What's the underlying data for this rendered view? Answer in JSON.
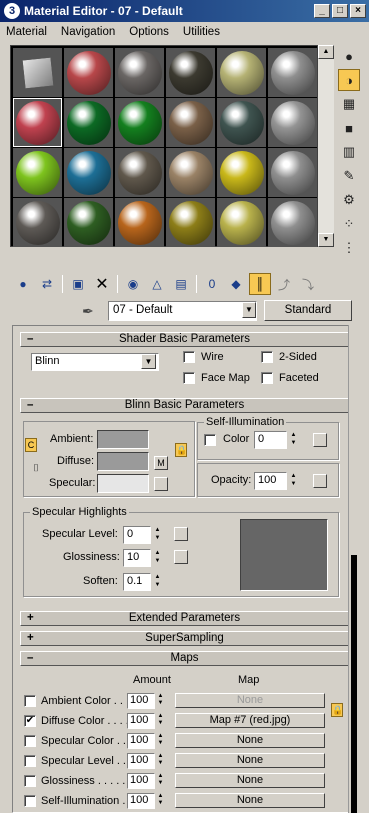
{
  "window": {
    "title": "Material Editor - 07 - Default",
    "logo": "3"
  },
  "menu": [
    "Material",
    "Navigation",
    "Options",
    "Utilities"
  ],
  "slots": [
    {
      "icon": "cube-icon"
    },
    {
      "color": "#b8474a"
    },
    {
      "color": "#6a6664"
    },
    {
      "color": "#3c3a30"
    },
    {
      "color": "#b5b274"
    },
    {
      "color": "#8f8f8f"
    },
    {
      "color": "#c0424f"
    },
    {
      "color": "#0c6a24"
    },
    {
      "color": "#14801f"
    },
    {
      "color": "#7a6048"
    },
    {
      "color": "#3f5450"
    },
    {
      "color": "#949494"
    },
    {
      "color": "#7ec41e"
    },
    {
      "color": "#1d6f96"
    },
    {
      "color": "#60584c"
    },
    {
      "color": "#9a8266"
    },
    {
      "color": "#c9b81a"
    },
    {
      "color": "#8f8f8f"
    },
    {
      "color": "#5e5a56"
    },
    {
      "color": "#2e5e22"
    },
    {
      "color": "#b8651c"
    },
    {
      "color": "#8d7e18"
    },
    {
      "color": "#b9b24c"
    },
    {
      "color": "#8f8f8f"
    }
  ],
  "right_toolbar": [
    "sample-type-sphere-icon",
    "backlight-icon",
    "background-checker-icon",
    "sample-uv-tiling-icon",
    "video-color-check-icon",
    "make-preview-icon",
    "options-icon",
    "select-by-material-icon",
    "material-map-navigator-icon"
  ],
  "horizontal_toolbar": [
    "get-material-icon",
    "put-to-scene-icon",
    "assign-to-selection-icon",
    "reset-map-icon",
    "make-copy-icon",
    "make-unique-icon",
    "put-to-library-icon",
    "material-id-channel-icon",
    "show-map-in-viewport-icon",
    "show-end-result-icon",
    "go-to-parent-icon",
    "go-forward-to-sibling-icon"
  ],
  "name": {
    "value": "07 - Default",
    "type": "Standard"
  },
  "shader_basic": {
    "title": "Shader Basic Parameters",
    "shader": "Blinn",
    "wire": "Wire",
    "two_sided": "2-Sided",
    "face_map": "Face Map",
    "faceted": "Faceted"
  },
  "blinn_basic": {
    "title": "Blinn Basic Parameters",
    "ambient": "Ambient:",
    "diffuse": "Diffuse:",
    "specular": "Specular:",
    "lock_m": "M",
    "self_illum": "Self-Illumination",
    "color": "Color",
    "color_value": "0",
    "opacity": "Opacity:",
    "opacity_value": "100",
    "ambient_color": "#9a9a9a",
    "diffuse_color": "#9a9a9a",
    "specular_color": "#e6e6e6"
  },
  "specular_highlights": {
    "title": "Specular Highlights",
    "level": "Specular Level:",
    "level_value": "0",
    "gloss": "Glossiness:",
    "gloss_value": "10",
    "soften": "Soften:",
    "soften_value": "0.1"
  },
  "rollouts": {
    "extended": "Extended Parameters",
    "supersampling": "SuperSampling",
    "maps": "Maps"
  },
  "maps": {
    "amount_header": "Amount",
    "map_header": "Map",
    "rows": [
      {
        "label": "Ambient Color . . .",
        "checked": "",
        "amount": "100",
        "map": "None",
        "dim": true
      },
      {
        "label": "Diffuse Color . . . .",
        "checked": "✔",
        "amount": "100",
        "map": "Map #7 (red.jpg)",
        "dim": false
      },
      {
        "label": "Specular Color . .",
        "checked": "",
        "amount": "100",
        "map": "None",
        "dim": false
      },
      {
        "label": "Specular Level . .",
        "checked": "",
        "amount": "100",
        "map": "None",
        "dim": false
      },
      {
        "label": "Glossiness . . . . .",
        "checked": "",
        "amount": "100",
        "map": "None",
        "dim": false
      },
      {
        "label": "Self-Illumination .",
        "checked": "",
        "amount": "100",
        "map": "None",
        "dim": false
      }
    ]
  }
}
